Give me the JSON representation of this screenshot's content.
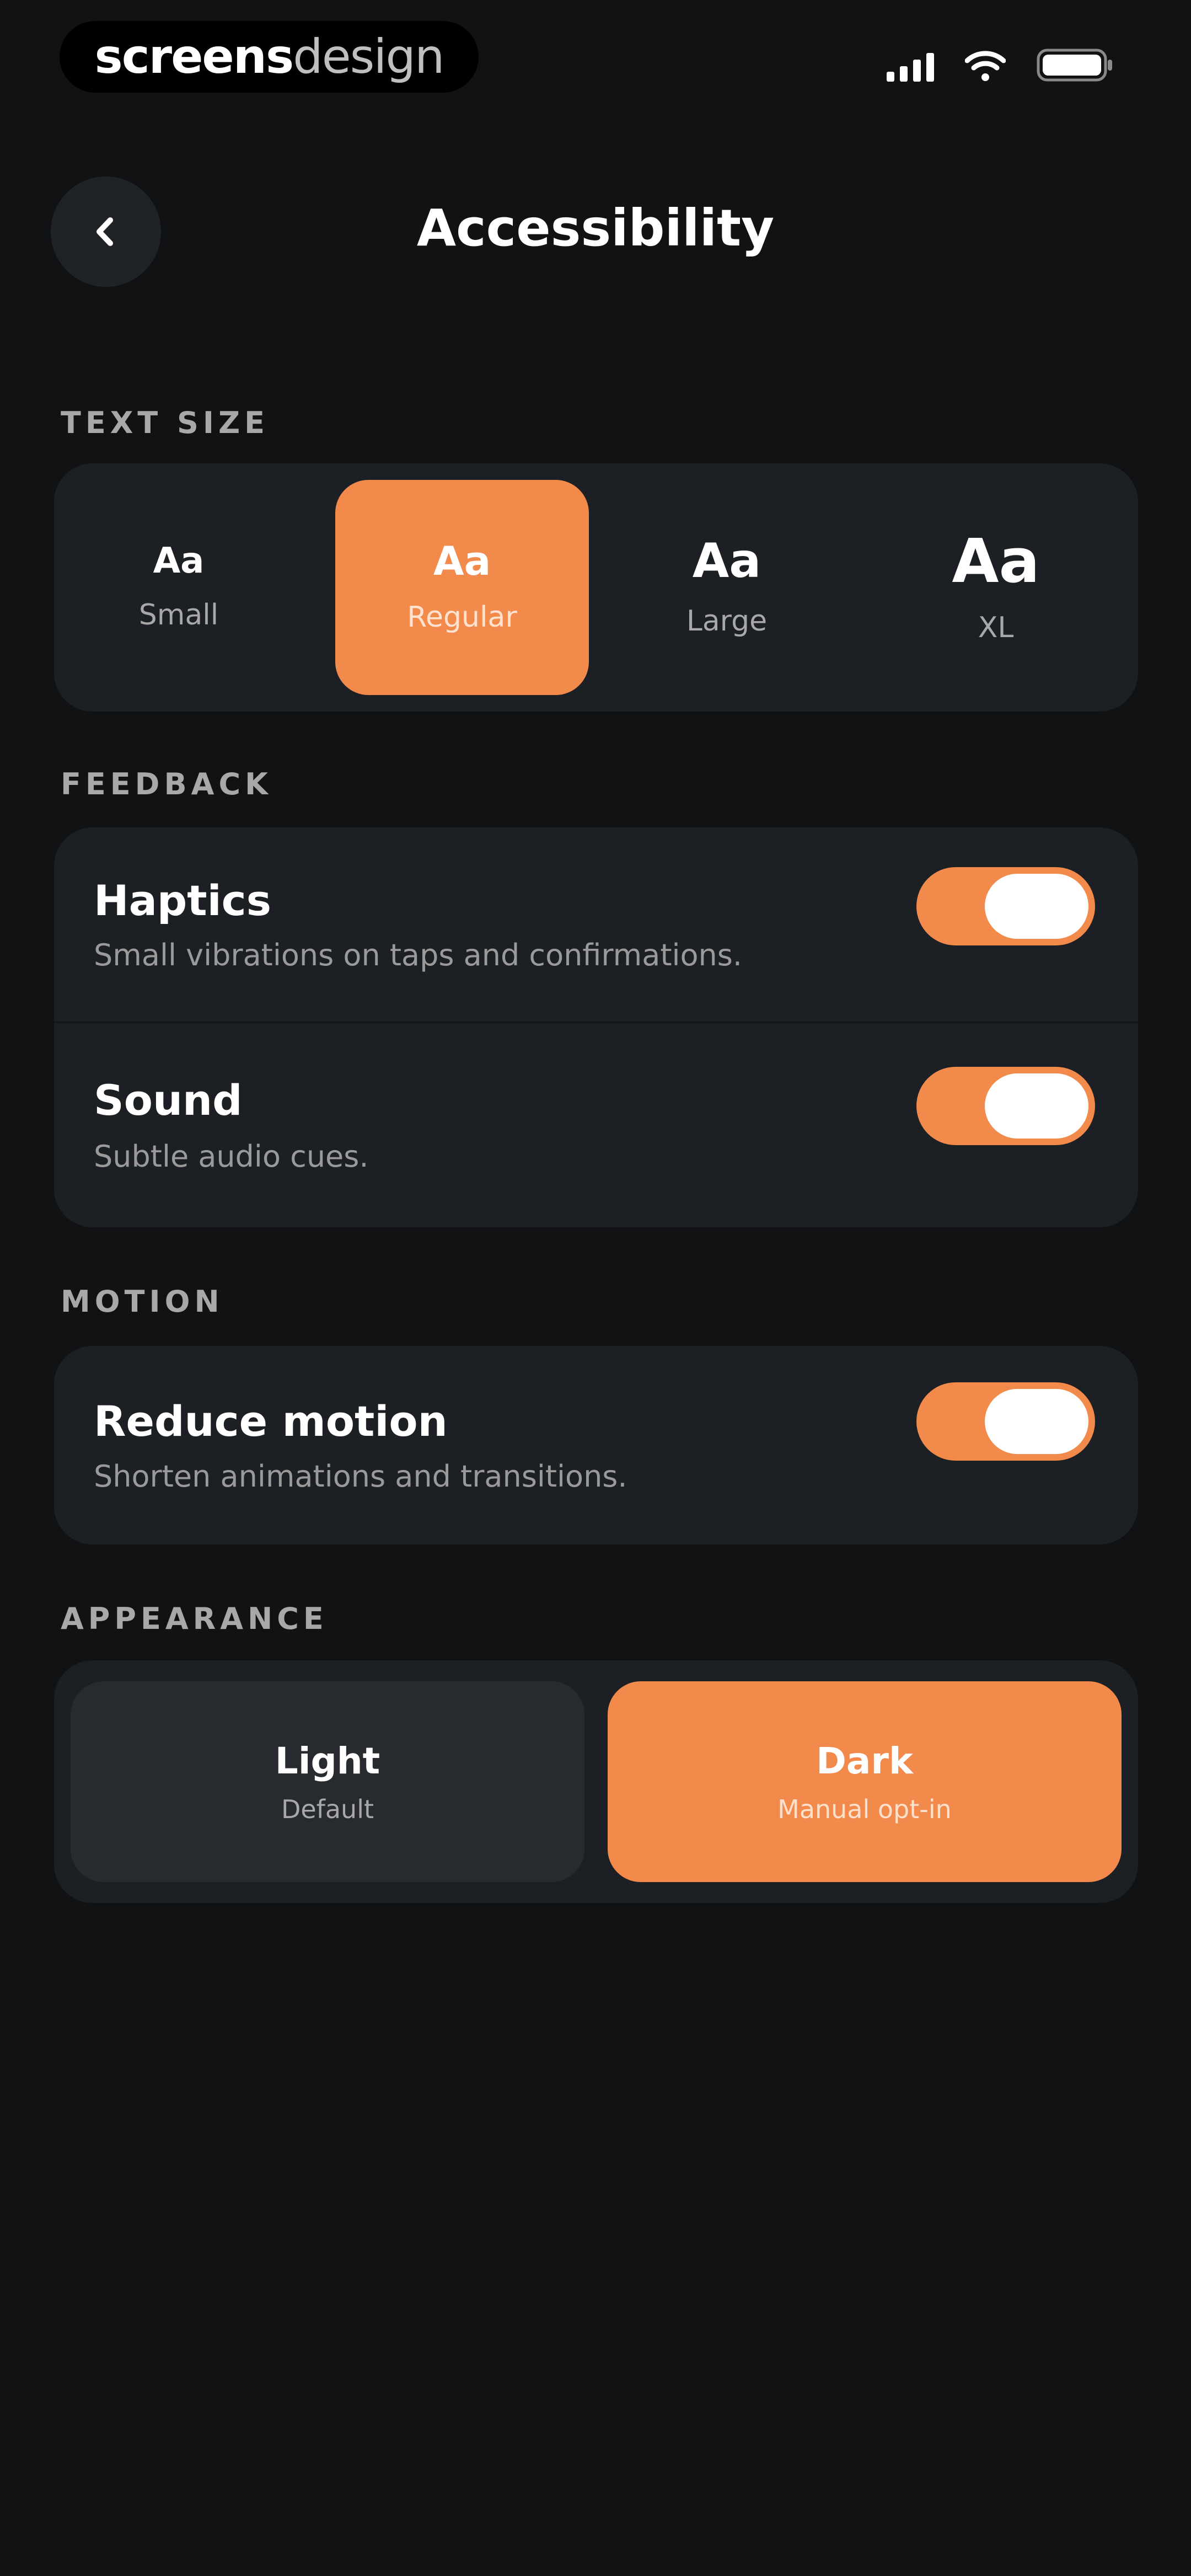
{
  "status_bar": {
    "brand_bold": "screens",
    "brand_light": "design"
  },
  "header": {
    "title": "Accessibility",
    "back_icon": "chevron-left-icon"
  },
  "text_size": {
    "section_label": "TEXT SIZE",
    "selected": "Regular",
    "options": [
      {
        "sample": "Aa",
        "label": "Small"
      },
      {
        "sample": "Aa",
        "label": "Regular"
      },
      {
        "sample": "Aa",
        "label": "Large"
      },
      {
        "sample": "Aa",
        "label": "XL"
      }
    ]
  },
  "feedback": {
    "section_label": "FEEDBACK",
    "items": [
      {
        "title": "Haptics",
        "subtitle": "Small vibrations on taps and confirmations.",
        "enabled": true
      },
      {
        "title": "Sound",
        "subtitle": "Subtle audio cues.",
        "enabled": true
      }
    ]
  },
  "motion": {
    "section_label": "MOTION",
    "items": [
      {
        "title": "Reduce motion",
        "subtitle": "Shorten animations and transitions.",
        "enabled": true
      }
    ]
  },
  "appearance": {
    "section_label": "APPEARANCE",
    "selected": "Dark",
    "options": [
      {
        "title": "Light",
        "subtitle": "Default"
      },
      {
        "title": "Dark",
        "subtitle": "Manual opt-in"
      }
    ]
  },
  "colors": {
    "background": "#111214",
    "card": "#1c1f23",
    "accent": "#f28a4b",
    "secondary_text": "#a8a8a8"
  }
}
